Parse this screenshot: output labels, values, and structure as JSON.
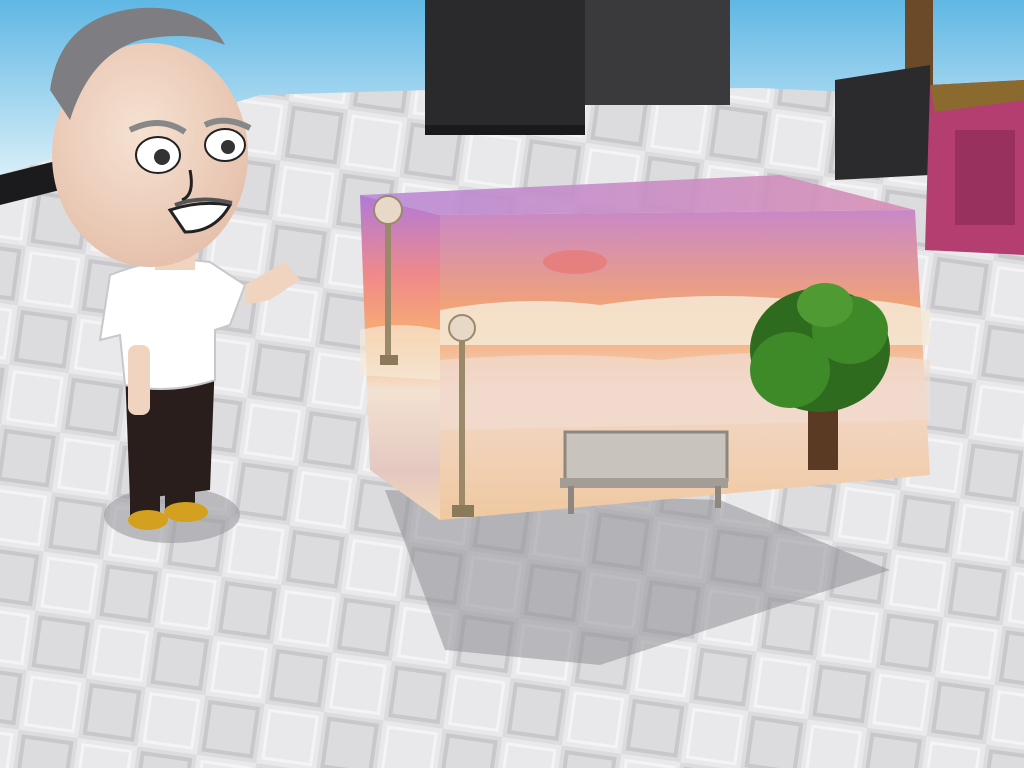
{
  "scene": {
    "type": "3d-game-room",
    "description_free": true,
    "colors": {
      "sky": "#7fc6e8",
      "floor_light": "#e6e6e8",
      "floor_dark": "#bdbdc2",
      "pillar": "#2a2a2c",
      "box_top": "#a86bd0",
      "box_sunset": "#f6a05a",
      "clouds": "#f3e3d8",
      "planter": "#b23a6a",
      "tree": "#2f6b1e",
      "shirt": "#ffffff",
      "pants": "#2a1e1c",
      "shoes": "#d4a020",
      "skin": "#f0d4c0"
    },
    "icons": [
      "character-avatar",
      "diorama-box",
      "lamp-post",
      "park-bench",
      "tree",
      "potted-plant",
      "pillar"
    ]
  }
}
